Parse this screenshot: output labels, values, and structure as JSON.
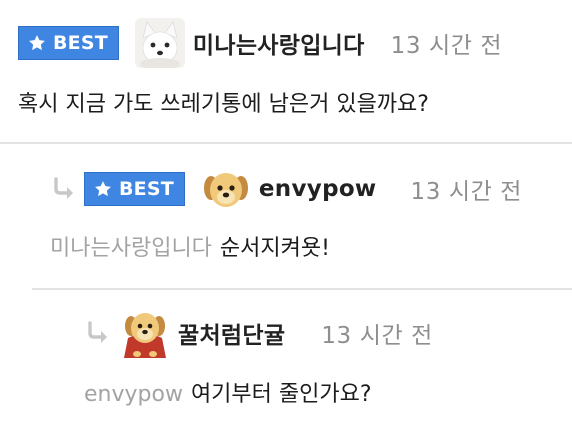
{
  "badge_label": "BEST",
  "comments": [
    {
      "username": "미나는사랑입니다",
      "time": "13 시간 전",
      "avatar": "white-fox-avatar",
      "best": true,
      "text": "혹시 지금 가도 쓰레기통에 남은거 있을까요?"
    },
    {
      "username": "envypow",
      "time": "13 시간 전",
      "avatar": "puppy-avatar",
      "best": true,
      "mention": "미나는사랑입니다",
      "text": "순서지켜욧!"
    },
    {
      "username": "꿀처럼단귤",
      "time": "13 시간 전",
      "avatar": "puppy-cape-avatar",
      "best": false,
      "mention": "envypow",
      "text": "여기부터 줄인가요?"
    }
  ],
  "colors": {
    "badge_bg": "#3f86e3",
    "time_text": "#8e8e8e",
    "mention_text": "#a3a3a3",
    "divider": "#e2e2e2"
  }
}
